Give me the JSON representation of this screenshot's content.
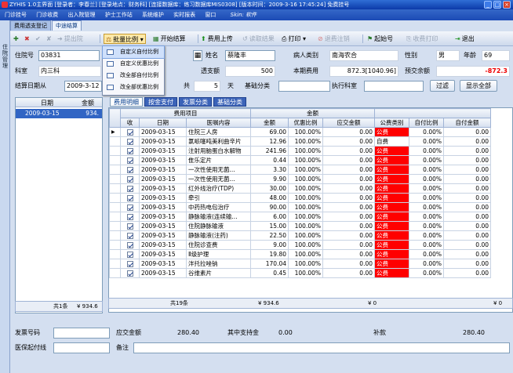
{
  "window": {
    "title": "ZYHIS 1.0主界面   [登录者：李春兰]   [登录地点：财务科]   [连接数据库：练习数据库MIS0308]   [版本时间：2009-3-16 17:45:24]   免费挂号",
    "min": "_",
    "max": "□",
    "close": "×"
  },
  "menu": {
    "items": [
      "门诊挂号",
      "门诊收费",
      "出入院管理",
      "护士工作站",
      "系统维护",
      "实时报表",
      "窗口"
    ],
    "skin": "Skin: 软件"
  },
  "sidebar": {
    "label": "住院管理"
  },
  "doc_tabs": [
    "费用透支登记",
    "中途结算"
  ],
  "toolbar": {
    "batch": "批量比例",
    "start": "开始结算",
    "upload": "费用上传",
    "read": "读取结果",
    "print": "打印",
    "cancel": "退费注销",
    "return": "起始号",
    "collect_print": "收费打印",
    "exit": "退出",
    "dis1": "提出院"
  },
  "dropdown": [
    "自定义自付比例",
    "自定义优惠比例",
    "改全部自付比例",
    "改全部优惠比例"
  ],
  "form": {
    "inpatient_no_label": "住院号",
    "inpatient_no": "03831",
    "name_label": "姓名",
    "name": "蔡隆丰",
    "patient_type_label": "病人类别",
    "patient_type": "南海农合",
    "sex_label": "性别",
    "sex": "男",
    "age_label": "年龄",
    "age": "69",
    "dept_label": "科室",
    "dept": "内三科",
    "overdraft_label": "透支额",
    "overdraft": "500",
    "cost_label": "本期费用",
    "cost": "872.3[1040.96]",
    "prepay_label": "预交余额",
    "prepay": "-872.3",
    "date_from_label": "结算日期从",
    "date_from": "2009-3-12",
    "total_label": "共",
    "total_days": "5",
    "days_label": "天",
    "basic_label": "基础分类",
    "exec_label": "执行科室",
    "filter": "过滤",
    "show_all": "显示全部"
  },
  "left": {
    "headers": [
      "日期",
      "金额"
    ],
    "rows": [
      {
        "date": "2009-03-15",
        "amount": "934."
      }
    ],
    "footer_count": "共1条",
    "footer_total": "¥ 934.6"
  },
  "subtabs": [
    "费用明细",
    "按金支付",
    "发票分类",
    "基础分类"
  ],
  "grid": {
    "header1": {
      "fee": "费用项目",
      "amount_group": "金额"
    },
    "headers": [
      "收",
      "日期",
      "医嘱内容",
      "金额",
      "优惠比例",
      "应交金额",
      "公费类别",
      "自付比例",
      "自付金额"
    ],
    "rows": [
      [
        "2009-03-15",
        "住院三人房",
        "69.00",
        "100.00%",
        "0.00",
        "公费",
        "0.00%",
        "0.00"
      ],
      [
        "2009-03-15",
        "氯哌噻吨美利曲辛片",
        "12.96",
        "100.00%",
        "0.00",
        "自费",
        "0.00%",
        "0.00"
      ],
      [
        "2009-03-15",
        "注射用脑蛋白水解物",
        "241.96",
        "100.00%",
        "0.00",
        "公费",
        "0.00%",
        "0.00"
      ],
      [
        "2009-03-15",
        "隹乐定片",
        "0.44",
        "100.00%",
        "0.00",
        "公费",
        "0.00%",
        "0.00"
      ],
      [
        "2009-03-15",
        "一次性使用无菌...",
        "3.30",
        "100.00%",
        "0.00",
        "公费",
        "0.00%",
        "0.00"
      ],
      [
        "2009-03-15",
        "一次性使用无菌...",
        "9.90",
        "100.00%",
        "0.00",
        "公费",
        "0.00%",
        "0.00"
      ],
      [
        "2009-03-15",
        "红外线治疗(TDP)",
        "30.00",
        "100.00%",
        "0.00",
        "公费",
        "0.00%",
        "0.00"
      ],
      [
        "2009-03-15",
        "牵引",
        "48.00",
        "100.00%",
        "0.00",
        "公费",
        "0.00%",
        "0.00"
      ],
      [
        "2009-03-15",
        "中药热电包治疗",
        "90.00",
        "100.00%",
        "0.00",
        "公费",
        "0.00%",
        "0.00"
      ],
      [
        "2009-03-15",
        "静脉输液(连续输...",
        "6.00",
        "100.00%",
        "0.00",
        "公费",
        "0.00%",
        "0.00"
      ],
      [
        "2009-03-15",
        "住院静脉输液",
        "15.00",
        "100.00%",
        "0.00",
        "公费",
        "0.00%",
        "0.00"
      ],
      [
        "2009-03-15",
        "静脉输液(注药)",
        "22.50",
        "100.00%",
        "0.00",
        "公费",
        "0.00%",
        "0.00"
      ],
      [
        "2009-03-15",
        "住院诊查费",
        "9.00",
        "100.00%",
        "0.00",
        "公费",
        "0.00%",
        "0.00"
      ],
      [
        "2009-03-15",
        "Ⅱ级护理",
        "19.80",
        "100.00%",
        "0.00",
        "公费",
        "0.00%",
        "0.00"
      ],
      [
        "2009-03-15",
        "泮托拉唑钠",
        "170.04",
        "100.00%",
        "0.00",
        "公费",
        "0.00%",
        "0.00"
      ],
      [
        "2009-03-15",
        "谷维素片",
        "0.45",
        "100.00%",
        "0.00",
        "公费",
        "0.00%",
        "0.00"
      ]
    ],
    "footer_count": "共19条",
    "footer_amount": "¥ 934.6",
    "footer_due": "¥ 0",
    "footer_self": "¥ 0"
  },
  "bottom": {
    "invoice_label": "发票号码",
    "receivable_label": "应交金额",
    "receivable": "280.40",
    "fund_label": "其中支持金",
    "fund": "0.00",
    "refund_label": "补款",
    "refund": "280.40",
    "insurance_label": "医保起付线",
    "note_label": "备注"
  }
}
